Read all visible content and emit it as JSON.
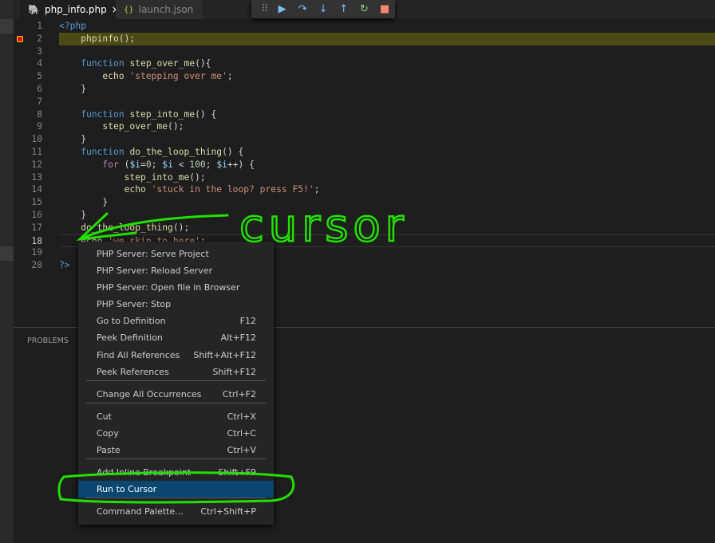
{
  "tabs": [
    {
      "label": "php_info.php",
      "icon": "php-elephant-icon",
      "active": true
    },
    {
      "label": "launch.json",
      "icon": "json-braces-icon",
      "active": false
    }
  ],
  "tab_close": "×",
  "debug_toolbar": [
    "drag-handle-icon",
    "continue-icon",
    "step-over-icon",
    "step-into-icon",
    "step-out-icon",
    "restart-icon",
    "stop-icon"
  ],
  "editor": {
    "current_line": 2,
    "cursor_line": 18,
    "lines": [
      "<?php",
      "    phpinfo();",
      "",
      "    function step_over_me(){",
      "        echo 'stepping over me';",
      "    }",
      "",
      "    function step_into_me() {",
      "        step_over_me();",
      "    }",
      "    function do_the_loop_thing() {",
      "        for ($i=0; $i < 100; $i++) {",
      "            step_into_me();",
      "            echo 'stuck in the loop? press F5!';",
      "        }",
      "    }",
      "    do_the_loop_thing();",
      "    echo 'we skip to here';",
      "",
      "?>"
    ]
  },
  "panel": {
    "tab": "PROBLEMS"
  },
  "context_menu": {
    "items": [
      {
        "label": "PHP Server: Serve Project",
        "shortcut": ""
      },
      {
        "label": "PHP Server: Reload Server",
        "shortcut": ""
      },
      {
        "label": "PHP Server: Open file in Browser",
        "shortcut": ""
      },
      {
        "label": "PHP Server: Stop",
        "shortcut": ""
      },
      {
        "label": "Go to Definition",
        "shortcut": "F12"
      },
      {
        "label": "Peek Definition",
        "shortcut": "Alt+F12"
      },
      {
        "label": "Find All References",
        "shortcut": "Shift+Alt+F12"
      },
      {
        "label": "Peek References",
        "shortcut": "Shift+F12"
      },
      {
        "label": "Change All Occurrences",
        "shortcut": "Ctrl+F2"
      },
      {
        "label": "Cut",
        "shortcut": "Ctrl+X"
      },
      {
        "label": "Copy",
        "shortcut": "Ctrl+C"
      },
      {
        "label": "Paste",
        "shortcut": "Ctrl+V"
      },
      {
        "label": "Add Inline Breakpoint",
        "shortcut": "Shift+F9"
      },
      {
        "label": "Run to Cursor",
        "shortcut": "",
        "highlighted": true
      },
      {
        "label": "Command Palette...",
        "shortcut": "Ctrl+Shift+P"
      }
    ]
  },
  "annotation": {
    "text": "cursor",
    "color": "#22e000"
  },
  "colors": {
    "accent": "#094771",
    "current_line": "#4b4b18"
  }
}
